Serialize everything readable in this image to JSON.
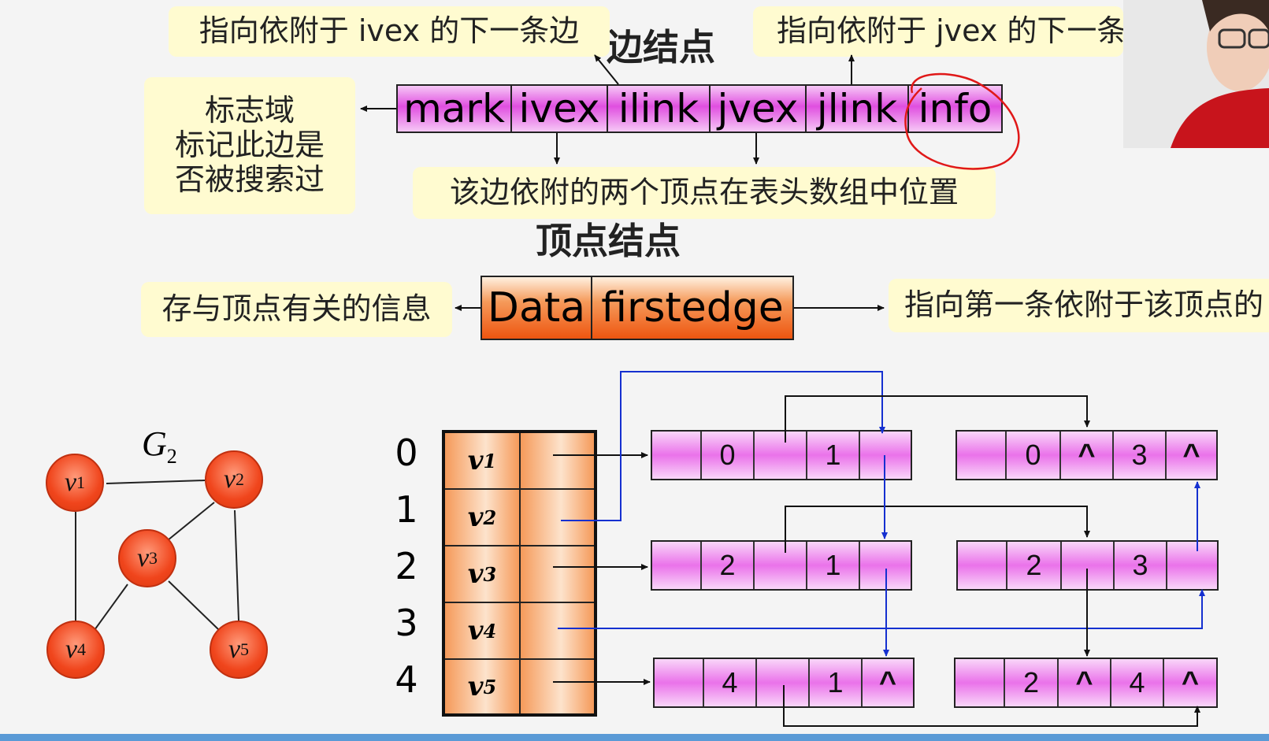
{
  "edge_node_title": "边结点",
  "vertex_node_title": "顶点结点",
  "edge_node_fields": [
    "mark",
    "ivex",
    "ilink",
    "jvex",
    "jlink",
    "info"
  ],
  "vertex_node_fields": [
    "Data",
    "firstedge"
  ],
  "notes": {
    "ilink": "指向依附于 ivex 的下一条边",
    "jlink": "指向依附于 jvex 的下一条边",
    "mark_line1": "标志域",
    "mark_line2": "标记此边是",
    "mark_line3": "否被搜索过",
    "ivex_jvex": "该边依附的两个顶点在表头数组中位置",
    "data": "存与顶点有关的信息",
    "firstedge": "指向第一条依附于该顶点的"
  },
  "graph": {
    "name": "G",
    "name_sub": "2",
    "nodes": [
      {
        "label": "v",
        "sub": "1"
      },
      {
        "label": "v",
        "sub": "2"
      },
      {
        "label": "v",
        "sub": "3"
      },
      {
        "label": "v",
        "sub": "4"
      },
      {
        "label": "v",
        "sub": "5"
      }
    ],
    "edges": [
      [
        "v1",
        "v2"
      ],
      [
        "v1",
        "v4"
      ],
      [
        "v2",
        "v3"
      ],
      [
        "v2",
        "v5"
      ],
      [
        "v3",
        "v4"
      ],
      [
        "v3",
        "v5"
      ]
    ]
  },
  "vertex_table": {
    "indices": [
      "0",
      "1",
      "2",
      "3",
      "4"
    ],
    "vertices": [
      {
        "label": "v",
        "sub": "1"
      },
      {
        "label": "v",
        "sub": "2"
      },
      {
        "label": "v",
        "sub": "3"
      },
      {
        "label": "v",
        "sub": "4"
      },
      {
        "label": "v",
        "sub": "5"
      }
    ]
  },
  "edge_nodes": [
    {
      "ivex": "0",
      "ilink": "",
      "jvex": "1",
      "jlink": ""
    },
    {
      "ivex": "0",
      "ilink": "^",
      "jvex": "3",
      "jlink": "^"
    },
    {
      "ivex": "2",
      "ilink": "",
      "jvex": "1",
      "jlink": ""
    },
    {
      "ivex": "2",
      "ilink": "",
      "jvex": "3",
      "jlink": ""
    },
    {
      "ivex": "4",
      "ilink": "",
      "jvex": "1",
      "jlink": "^"
    },
    {
      "ivex": "2",
      "ilink": "^",
      "jvex": "4",
      "jlink": "^"
    }
  ]
}
